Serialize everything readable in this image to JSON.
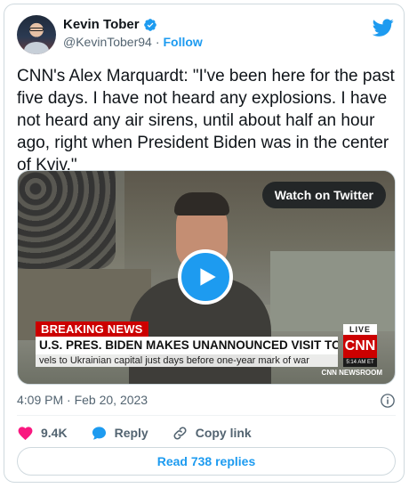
{
  "author": {
    "name": "Kevin Tober",
    "handle": "@KevinTober94",
    "separator": "·",
    "follow_label": "Follow"
  },
  "tweet": {
    "text": "CNN's Alex Marquardt: \"I've been here for the past five days. I have not heard any explosions. I have not heard any air sirens, until about half an hour ago, right when President Biden was in the center of Kyiv.\""
  },
  "media": {
    "watch_label": "Watch on Twitter",
    "chyron": {
      "breaking": "BREAKING NEWS",
      "headline": "U.S. PRES. BIDEN MAKES UNANNOUNCED VISIT TO KYIV",
      "subhead": "vels to Ukrainian capital just days before one-year mark of war",
      "live": "LIVE",
      "network": "CNN",
      "time": "5:14 AM ET",
      "program": "CNN NEWSROOM"
    }
  },
  "meta": {
    "timestamp": "4:09 PM · Feb 20, 2023"
  },
  "actions": {
    "likes": "9.4K",
    "reply_label": "Reply",
    "copy_label": "Copy link"
  },
  "footer": {
    "replies_label": "Read 738 replies"
  },
  "colors": {
    "accent": "#1d9bf0",
    "like": "#f91880",
    "breaking_red": "#cc0000"
  },
  "icons": [
    "verified-badge-icon",
    "twitter-bird-icon",
    "play-icon",
    "info-icon",
    "heart-icon",
    "reply-icon",
    "link-icon"
  ]
}
